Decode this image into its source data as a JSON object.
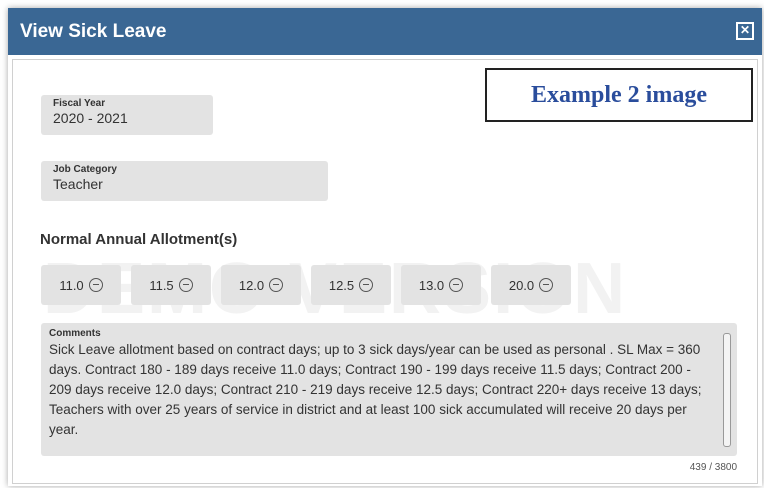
{
  "dialog": {
    "title": "View Sick Leave",
    "close_icon": "close-box-icon"
  },
  "example_label": "Example 2 image",
  "watermark": "DEMO VERSION",
  "fiscal_year": {
    "label": "Fiscal Year",
    "value": "2020 - 2021"
  },
  "job_category": {
    "label": "Job Category",
    "value": "Teacher"
  },
  "allotments": {
    "title": "Normal Annual Allotment(s)",
    "items": [
      {
        "value": "11.0"
      },
      {
        "value": "11.5"
      },
      {
        "value": "12.0"
      },
      {
        "value": "12.5"
      },
      {
        "value": "13.0"
      },
      {
        "value": "20.0"
      }
    ]
  },
  "comments": {
    "label": "Comments",
    "text": "Sick Leave allotment based on contract days; up to 3 sick days/year can be used as personal . SL Max = 360 days.  Contract 180 - 189 days receive 11.0 days; Contract 190 - 199 days receive 11.5 days; Contract 200 - 209 days receive 12.0 days; Contract 210 - 219 days receive 12.5 days; Contract 220+ days receive 13 days; Teachers with over 25 years of service in district and at least 100 sick accumulated  will receive 20 days per year.",
    "counter": "439 / 3800"
  },
  "colors": {
    "titlebar": "#3a6794",
    "field_bg": "#e3e3e3",
    "example_text": "#2a4d9c"
  }
}
